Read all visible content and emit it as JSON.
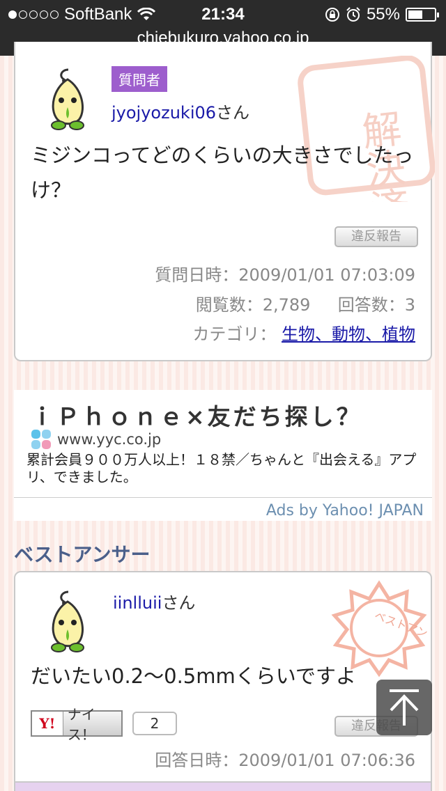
{
  "status_bar": {
    "carrier": "SoftBank",
    "time": "21:34",
    "battery": "55%",
    "battery_level": 0.55
  },
  "url_bar": {
    "url": "chiebukuro.yahoo.co.jp"
  },
  "question": {
    "badge": "質問者",
    "username": "jyojyozuki06",
    "honorific": "さん",
    "text": "ミジンコってどのくらいの大きさでしたっけ？",
    "report_label": "違反報告",
    "date_label": "質問日時：",
    "date": "2009/01/01 07:03:09",
    "views_label": "閲覧数：",
    "views": "2,789",
    "answers_label": "回答数：",
    "answers": "3",
    "category_label": "カテゴリ：",
    "category": "生物、動物、植物",
    "stamp_text": "解決済み"
  },
  "ad": {
    "title": "ｉＰｈｏｎｅ×友だち探し？",
    "domain": "www.yyc.co.jp",
    "description": "累計会員９００万人以上！１８禁／ちゃんと『出会える』アプリ、できました。",
    "footer": "Ads by Yahoo! JAPAN"
  },
  "best_answer": {
    "section_title": "ベストアンサー",
    "username": "iinlluii",
    "honorific": "さん",
    "text": "だいたい0.2〜0.5mmくらいですよ",
    "nice_logo": "Y!",
    "nice_label": "ナイス！",
    "nice_count": "2",
    "report_label": "違反報告",
    "date_label": "回答日時：",
    "date": "2009/01/01 07:06:36",
    "stamp_text": "ベストアンサー"
  },
  "icons": [
    "wifi-icon",
    "rotation-lock-icon",
    "alarm-icon",
    "battery-icon",
    "mascot-avatar-icon",
    "clover-icon",
    "scroll-top-arrow-icon"
  ]
}
